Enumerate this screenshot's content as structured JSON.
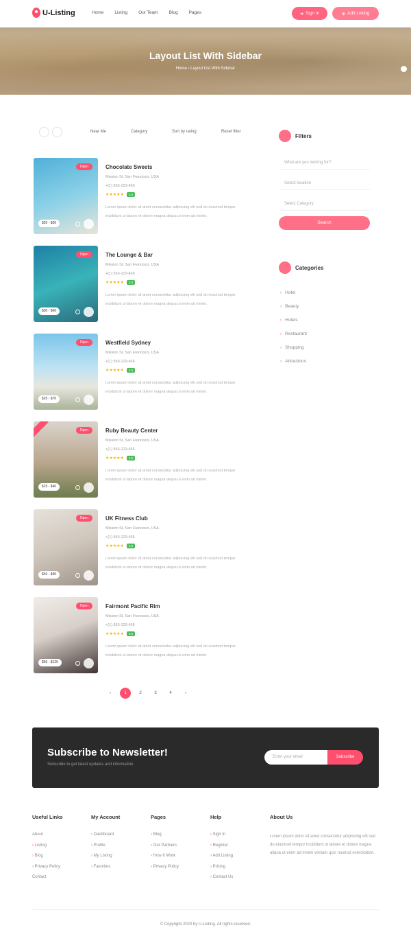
{
  "header": {
    "logo": "U-Listing",
    "nav": [
      "Home",
      "Listing",
      "Our Team",
      "Blog",
      "Pages"
    ],
    "sign_in": "Sign In",
    "add_listing": "Add Listing"
  },
  "hero": {
    "title": "Layout List With Sidebar",
    "breadcrumb": "Home  ›  Layout List With Sidebar"
  },
  "toolbar": {
    "items": [
      "Near Me",
      "Category",
      "Sort by rating",
      "Reset filter"
    ]
  },
  "listings": [
    {
      "title": "Chocolate Sweets",
      "address": "Mission St, San Francisco, USA",
      "phone": "+(1) 555-123-456",
      "badge": "Open",
      "price": "$20 - $50",
      "rating": "4.5",
      "description": "Lorem ipsum dolor sit amet consectetur adipiscing elit sed do eiusmod tempor incididunt ut labore et dolore magna aliqua ut enim ad minim."
    },
    {
      "title": "The Lounge & Bar",
      "address": "Mission St, San Francisco, USA",
      "phone": "+(1) 555-123-456",
      "badge": "Open",
      "price": "$30 - $60",
      "rating": "4.5",
      "description": "Lorem ipsum dolor sit amet consectetur adipiscing elit sed do eiusmod tempor incididunt ut labore et dolore magna aliqua ut enim ad minim."
    },
    {
      "title": "Westfield Sydney",
      "address": "Mission St, San Francisco, USA",
      "phone": "+(1) 555-123-456",
      "badge": "Open",
      "price": "$25 - $70",
      "rating": "4.5",
      "description": "Lorem ipsum dolor sit amet consectetur adipiscing elit sed do eiusmod tempor incididunt ut labore et dolore magna aliqua ut enim ad minim."
    },
    {
      "title": "Ruby Beauty Center",
      "address": "Mission St, San Francisco, USA",
      "phone": "+(1) 555-123-456",
      "badge": "Open",
      "price": "$15 - $40",
      "rating": "4.5",
      "description": "Lorem ipsum dolor sit amet consectetur adipiscing elit sed do eiusmod tempor incididunt ut labore et dolore magna aliqua ut enim ad minim."
    },
    {
      "title": "UK Fitness Club",
      "address": "Mission St, San Francisco, USA",
      "phone": "+(1) 555-123-456",
      "badge": "Open",
      "price": "$40 - $90",
      "rating": "4.5",
      "description": "Lorem ipsum dolor sit amet consectetur adipiscing elit sed do eiusmod tempor incididunt ut labore et dolore magna aliqua ut enim ad minim."
    },
    {
      "title": "Fairmont Pacific Rim",
      "address": "Mission St, San Francisco, USA",
      "phone": "+(1) 555-123-456",
      "badge": "Open",
      "price": "$60 - $120",
      "rating": "4.5",
      "description": "Lorem ipsum dolor sit amet consectetur adipiscing elit sed do eiusmod tempor incididunt ut labore et dolore magna aliqua ut enim ad minim."
    }
  ],
  "pagination": [
    "‹",
    "1",
    "2",
    "3",
    "4",
    "›"
  ],
  "sidebar": {
    "filters_title": "Filters",
    "keyword_placeholder": "What are you looking for?",
    "location_placeholder": "Select location",
    "category_placeholder": "Select Category",
    "search_label": "Search",
    "categories_title": "Categories",
    "categories": [
      "Hotel",
      "Beauty",
      "Hotels",
      "Restaurant",
      "Shopping",
      "Attractions"
    ]
  },
  "newsletter": {
    "title": "Subscribe to Newsletter!",
    "subtitle": "Subscribe to get latest updates and information.",
    "input_placeholder": "Enter your email",
    "button": "Subscribe"
  },
  "footer": {
    "useful_links": {
      "title": "Useful Links",
      "items": [
        "About",
        "Listing",
        "Blog",
        "Privacy Policy",
        "Contact"
      ]
    },
    "my_account": {
      "title": "My Account",
      "items": [
        "Dashboard",
        "Profile",
        "My Listing",
        "Favorites"
      ]
    },
    "pages": {
      "title": "Pages",
      "items": [
        "Blog",
        "Our Partners",
        "How It Work",
        "Privacy Policy"
      ]
    },
    "help": {
      "title": "Help",
      "items": [
        "Sign In",
        "Register",
        "Add Listing",
        "Pricing",
        "Contact Us"
      ]
    },
    "about": {
      "title": "About Us",
      "text": "Lorem ipsum dolor sit amet consectetur adipiscing elit sed do eiusmod tempor incididunt ut labore et dolore magna aliqua ut enim ad minim veniam quis nostrud exercitation."
    },
    "copyright": "© Copyright 2020 by U-Listing. All rights reserved."
  },
  "colors": {
    "accent": "#ff4f6e",
    "dark": "#2a2a2a"
  }
}
